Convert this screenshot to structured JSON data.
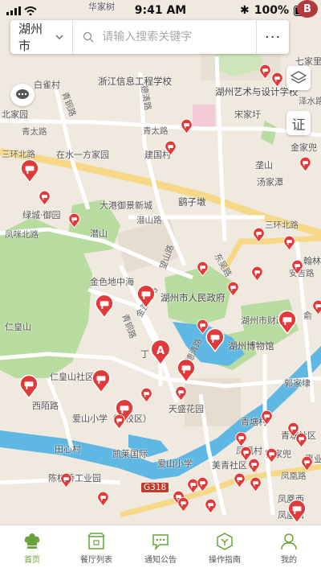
{
  "status": {
    "time": "9:41 AM",
    "battery": "100%"
  },
  "search": {
    "city": "湖州市",
    "placeholder": "请输入搜索关键字",
    "more": "···"
  },
  "controls": {
    "cert_label": "证",
    "badge_label": "B"
  },
  "map": {
    "labels": {
      "l1": "华家树",
      "l2": "白雀村",
      "l3": "浙江信息工程学校",
      "l4": "七家里",
      "l5": "湖州艺术与设计学校",
      "l6": "泽水路",
      "l7": "北家园",
      "l8": "青太路",
      "l9": "宋家圩",
      "l10": "青太路",
      "l11": "金家兜",
      "l12": "三环北路",
      "l13": "在水一方家园",
      "l14": "建国村",
      "l15": "垄山",
      "l16": "汤家潭",
      "l17": "大港御景新城",
      "l18": "鹞子墩",
      "l19": "绿城·御园",
      "l20": "凤咪北路",
      "l21": "潜山路",
      "l22": "潜山",
      "l23": "三环北路",
      "l24": "翰林",
      "l25": "安吉路",
      "l26": "金色地中海",
      "l27": "湖州市人民政府",
      "l28": "湖州市财政局",
      "l29": "仁皇山",
      "l30": "湖州博物馆",
      "l31": "仁皇山社区",
      "l32": "郭家埭",
      "l33": "西陌路",
      "l34": "天盛花园",
      "l35": "爱山小学（西校区）",
      "l36": "青塘村",
      "l37": "青塘社区",
      "l38": "田心村",
      "l39": "凯莱国际",
      "l40": "凤凰村",
      "l41": "钱家兜",
      "l42": "嘉业",
      "l43": "爱山小学",
      "l44": "美青社区",
      "l45": "陈板桥工业园",
      "l46": "凤凰路",
      "l47": "G318",
      "l48": "凤凰西",
      "l49": "青铜路",
      "l50": "德清路",
      "l51": "望山路",
      "l52": "东吴路",
      "l53": "青铜路",
      "l54": "金盖山路",
      "l55": "德清路",
      "l56": "凤凰四",
      "l57": "丁",
      "l58": "俞"
    }
  },
  "tabs": [
    {
      "label": "首页",
      "icon": "chef-hat-icon"
    },
    {
      "label": "餐厅列表",
      "icon": "restaurant-list-icon"
    },
    {
      "label": "通知公告",
      "icon": "chat-bubble-icon"
    },
    {
      "label": "操作指南",
      "icon": "guide-icon"
    },
    {
      "label": "我的",
      "icon": "person-icon"
    }
  ],
  "colors": {
    "accent": "#6aa23a",
    "marker": "#e03a3a",
    "park": "#b8dba0",
    "water": "#5fb7e4",
    "road_major": "#f7d887"
  }
}
